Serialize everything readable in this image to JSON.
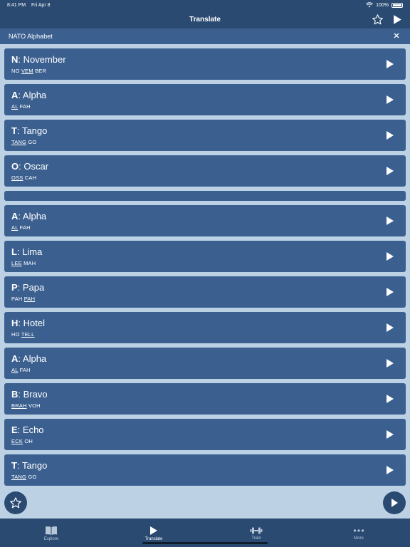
{
  "status": {
    "time": "8:41 PM",
    "date": "Fri Apr 8",
    "battery": "100%"
  },
  "nav": {
    "title": "Translate"
  },
  "subheader": {
    "label": "NATO Alphabet"
  },
  "items": [
    {
      "letter": "N",
      "word": "November",
      "syllables": [
        {
          "t": "NO",
          "s": false
        },
        {
          "t": "VEM",
          "s": true
        },
        {
          "t": "BER",
          "s": false
        }
      ]
    },
    {
      "letter": "A",
      "word": "Alpha",
      "syllables": [
        {
          "t": "AL",
          "s": true
        },
        {
          "t": "FAH",
          "s": false
        }
      ]
    },
    {
      "letter": "T",
      "word": "Tango",
      "syllables": [
        {
          "t": "TANG",
          "s": true
        },
        {
          "t": "GO",
          "s": false
        }
      ]
    },
    {
      "letter": "O",
      "word": "Oscar",
      "syllables": [
        {
          "t": "OSS",
          "s": true
        },
        {
          "t": "CAH",
          "s": false
        }
      ]
    },
    {
      "spacer": true
    },
    {
      "letter": "A",
      "word": "Alpha",
      "syllables": [
        {
          "t": "AL",
          "s": true
        },
        {
          "t": "FAH",
          "s": false
        }
      ]
    },
    {
      "letter": "L",
      "word": "Lima",
      "syllables": [
        {
          "t": "LEE",
          "s": true
        },
        {
          "t": "MAH",
          "s": false
        }
      ]
    },
    {
      "letter": "P",
      "word": "Papa",
      "syllables": [
        {
          "t": "PAH",
          "s": false
        },
        {
          "t": "PAH",
          "s": true
        }
      ]
    },
    {
      "letter": "H",
      "word": "Hotel",
      "syllables": [
        {
          "t": "HO",
          "s": false
        },
        {
          "t": "TELL",
          "s": true
        }
      ]
    },
    {
      "letter": "A",
      "word": "Alpha",
      "syllables": [
        {
          "t": "AL",
          "s": true
        },
        {
          "t": "FAH",
          "s": false
        }
      ]
    },
    {
      "letter": "B",
      "word": "Bravo",
      "syllables": [
        {
          "t": "BRAH",
          "s": true
        },
        {
          "t": "VOH",
          "s": false
        }
      ]
    },
    {
      "letter": "E",
      "word": "Echo",
      "syllables": [
        {
          "t": "ECK",
          "s": true
        },
        {
          "t": "OH",
          "s": false
        }
      ]
    },
    {
      "letter": "T",
      "word": "Tango",
      "syllables": [
        {
          "t": "TANG",
          "s": true
        },
        {
          "t": "GO",
          "s": false
        }
      ]
    }
  ],
  "tabs": [
    {
      "label": "Explore",
      "icon": "book-icon",
      "active": false
    },
    {
      "label": "Translate",
      "icon": "play-icon",
      "active": true
    },
    {
      "label": "Train",
      "icon": "dumbbell-icon",
      "active": false
    },
    {
      "label": "More",
      "icon": "ellipsis-icon",
      "active": false
    }
  ],
  "colors": {
    "bar": "#2a4a72",
    "card": "#3b6090",
    "background": "#bcd1e4"
  }
}
